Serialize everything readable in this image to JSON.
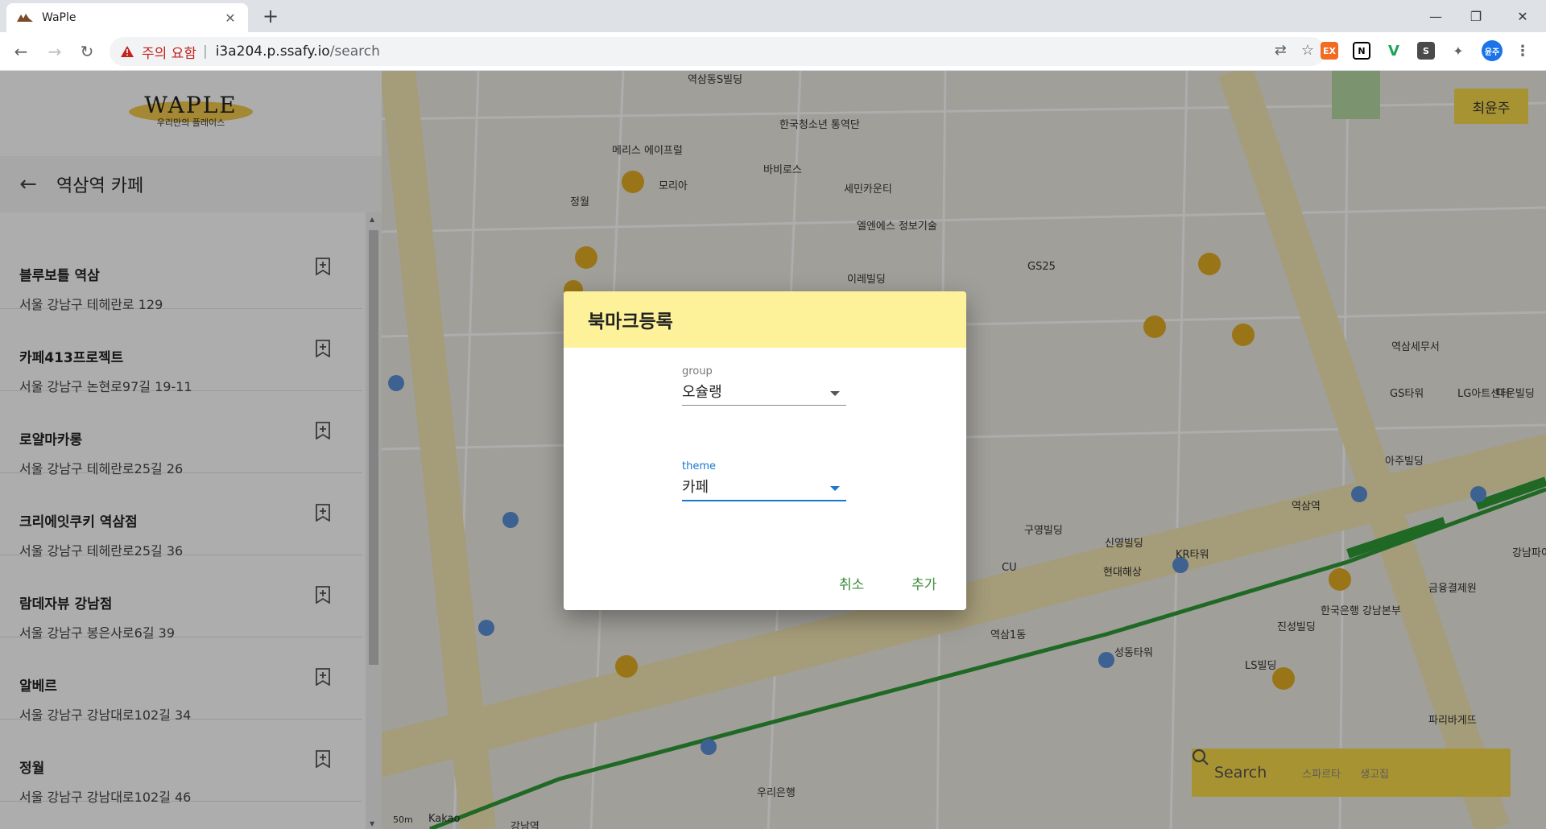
{
  "browser": {
    "tab_title": "WaPle",
    "security_warning": "주의 요함",
    "url_host": "i3a204.p.ssafy.io",
    "url_path": "/search",
    "profile_label": "윤주"
  },
  "sidebar": {
    "logo_text": "WAPLE",
    "logo_sub": "우리만의 플레이스",
    "header_title": "역삼역 카페",
    "items": [
      {
        "name": "블루보틀 역삼",
        "address": "서울 강남구 테헤란로 129"
      },
      {
        "name": "카페413프로젝트",
        "address": "서울 강남구 논현로97길 19-11"
      },
      {
        "name": "로얄마카롱",
        "address": "서울 강남구 테헤란로25길 26"
      },
      {
        "name": "크리에잇쿠키 역삼점",
        "address": "서울 강남구 테헤란로25길 36"
      },
      {
        "name": "람데자뷰 강남점",
        "address": "서울 강남구 봉은사로6길 39"
      },
      {
        "name": "알베르",
        "address": "서울 강남구 강남대로102길 34"
      },
      {
        "name": "정월",
        "address": "서울 강남구 강남대로102길 46"
      }
    ]
  },
  "map": {
    "user_button": "최윤주",
    "search_placeholder": "Search",
    "search_tab_1": "스파르타",
    "search_tab_2": "생고집",
    "scale_label": "50m",
    "brand": "Kakao",
    "labels": [
      "역삼역",
      "강남역",
      "역삼1동",
      "GS25",
      "CU",
      "신영빌딩",
      "구영빌딩",
      "LG아트센터",
      "역삼세무서",
      "우리은행",
      "강남파이낸스센터",
      "한국은행 강남본부",
      "정월",
      "모리아",
      "메리스 에이프럴",
      "역삼동S빌딩",
      "한국청소년 통역단",
      "바비로스",
      "세민카운티",
      "엘엔에스 정보기술",
      "이레빌딩",
      "GS타워",
      "다운빌딩",
      "아주빌딩",
      "금융결제원",
      "진성빌딩",
      "LS빌딩",
      "파리바게뜨",
      "성동타워",
      "현대해상",
      "KR타워"
    ]
  },
  "dialog": {
    "title": "북마크등록",
    "group_label": "group",
    "group_value": "오슐랭",
    "theme_label": "theme",
    "theme_value": "카페",
    "cancel": "취소",
    "add": "추가"
  },
  "colors": {
    "accent_yellow": "#f6d94a",
    "dialog_header": "#fdf19a",
    "focus_blue": "#1976d2",
    "button_green": "#3a8c3a",
    "warning_red": "#c5221f"
  }
}
